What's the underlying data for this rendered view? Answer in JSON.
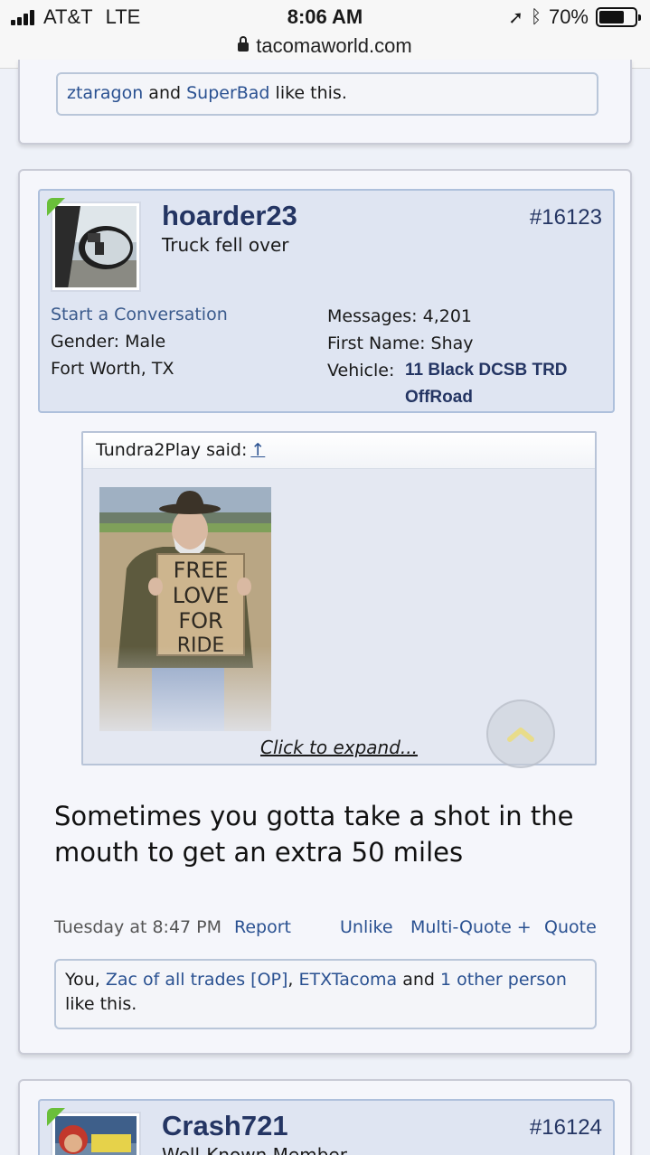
{
  "status_bar": {
    "carrier": "AT&T",
    "network": "LTE",
    "time": "8:06 AM",
    "battery": "70%",
    "battery_level": 0.7,
    "url": "tacomaworld.com"
  },
  "previous_post": {
    "likes": {
      "user1": "ztaragon",
      "and": "and",
      "user2": "SuperBad",
      "suffix": "like this."
    }
  },
  "post": {
    "username": "hoarder23",
    "user_title": "Truck fell over",
    "post_number": "#16123",
    "start_conversation": "Start a Conversation",
    "gender_label": "Gender:",
    "gender": "Male",
    "location": "Fort Worth, TX",
    "messages_label": "Messages:",
    "messages": "4,201",
    "first_name_label": "First Name:",
    "first_name": "Shay",
    "vehicle_label": "Vehicle:",
    "vehicle_line1": "11 Black DCSB TRD",
    "vehicle_line2": "OffRoad",
    "quote": {
      "author": "Tundra2Play said:",
      "arrow": "↑",
      "sign_lines": [
        "FREE",
        "LOVE",
        "FOR",
        "RIDE"
      ],
      "expand": "Click to expand..."
    },
    "message_line1": "Sometimes you gotta take a shot in the",
    "message_line2": "mouth to get an extra 50 miles",
    "timestamp": "Tuesday at 8:47 PM",
    "report": "Report",
    "unlike": "Unlike",
    "multiquote": "Multi-Quote +",
    "quote_btn": "Quote",
    "likes": {
      "you": "You,",
      "user1": "Zac of all trades [OP]",
      "comma": ",",
      "user2": "ETXTacoma",
      "and": "and",
      "others": "1 other person",
      "suffix": "like this."
    }
  },
  "next_post": {
    "username": "Crash721",
    "post_number": "#16124",
    "user_title": "Well-Known Member"
  }
}
